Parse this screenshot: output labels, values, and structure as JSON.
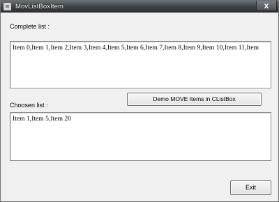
{
  "window": {
    "title": "MovListBoxItem",
    "close_glyph": "x",
    "icon": "app-icon",
    "close_icon": "close-icon"
  },
  "complete_list": {
    "label": "Complete list :",
    "items_text": "Item 0,Item 1,Item 2,Item 3,Item 4,Item 5,Item 6,Item 7,Item 8,Item 9,Item 10,Item 11,Item"
  },
  "chosen_list": {
    "label": "Choosen list :",
    "items_text": "Item 1,Item 5,Item 20"
  },
  "buttons": {
    "demo_label": "Demo MOVE Items in CListBox",
    "exit_label": "Exit"
  }
}
